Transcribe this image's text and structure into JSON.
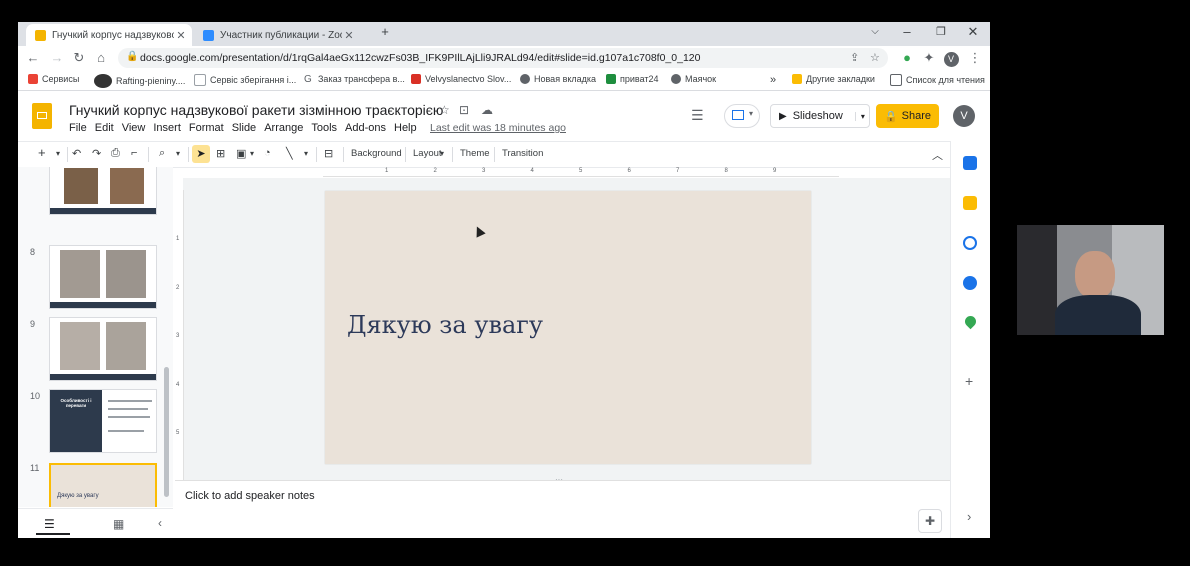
{
  "browser": {
    "tabs": [
      {
        "title": "Гнучкий корпус надзвукової ра",
        "active": true
      },
      {
        "title": "Участник публикации - Zoom",
        "active": false
      }
    ],
    "address": "docs.google.com/presentation/d/1rqGal4aeGx112cwzFs03B_IFK9PIlLAjLli9JRALd94/edit#slide=id.g107a1c708f0_0_120",
    "profile_initial": "V",
    "bookmarks": [
      {
        "label": "Сервисы"
      },
      {
        "label": "Rafting-pieniny...."
      },
      {
        "label": "Сервіс зберігання і..."
      },
      {
        "label": "Заказ трансфера в..."
      },
      {
        "label": "Velvyslanectvo Slov..."
      },
      {
        "label": "Новая вкладка"
      },
      {
        "label": "приват24"
      },
      {
        "label": "Маячок"
      }
    ],
    "bookmarks_overflow": "»",
    "other_bookmarks": "Другие закладки",
    "reading_list": "Список для чтения"
  },
  "docs": {
    "title": "Гнучкий корпус надзвукової ракети зізмінною траєкторією",
    "menus": [
      "File",
      "Edit",
      "View",
      "Insert",
      "Format",
      "Slide",
      "Arrange",
      "Tools",
      "Add-ons",
      "Help"
    ],
    "last_edit": "Last edit was 18 minutes ago",
    "slideshow_label": "Slideshow",
    "share_label": "Share",
    "user_initial": "V"
  },
  "toolbar": {
    "background": "Background",
    "layout": "Layout",
    "theme": "Theme",
    "transition": "Transition"
  },
  "filmstrip": {
    "slides": [
      {
        "num": "",
        "caption": "Експериментальні зразки"
      },
      {
        "num": "8",
        "caption": "Модель"
      },
      {
        "num": "9",
        "caption": "Модель"
      },
      {
        "num": "10",
        "title": "Особливості і переваги"
      },
      {
        "num": "11",
        "text": "Дякую за увагу"
      }
    ]
  },
  "slide": {
    "title": "Дякую за увагу"
  },
  "notes": {
    "placeholder": "Click to add speaker notes"
  },
  "ruler": {
    "h_ticks": [
      "1",
      "2",
      "3",
      "4",
      "5",
      "6",
      "7",
      "8",
      "9"
    ],
    "v_ticks": [
      "1",
      "2",
      "3",
      "4",
      "5"
    ]
  }
}
